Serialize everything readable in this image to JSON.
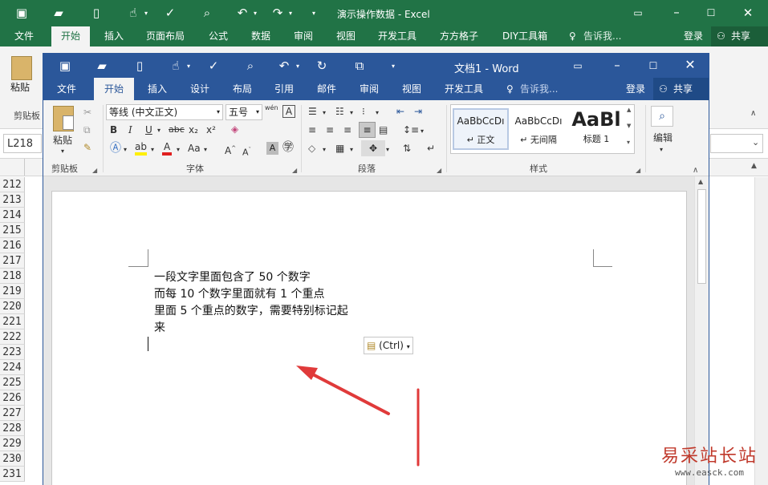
{
  "excel": {
    "window_title": "演示操作数据 - Excel",
    "tabs": [
      "文件",
      "开始",
      "插入",
      "页面布局",
      "公式",
      "数据",
      "审阅",
      "视图",
      "开发工具",
      "方方格子",
      "DIY工具箱"
    ],
    "tell_me": "告诉我...",
    "login": "登录",
    "share": "共享",
    "paste_label": "粘贴",
    "clipboard_label": "剪贴板",
    "name_box": "L218",
    "row_numbers": [
      "212",
      "213",
      "214",
      "215",
      "216",
      "217",
      "218",
      "219",
      "220",
      "221",
      "222",
      "223",
      "224",
      "225",
      "226",
      "227",
      "228",
      "229",
      "230",
      "231"
    ]
  },
  "word": {
    "window_title": "文档1 - Word",
    "tabs": [
      "文件",
      "开始",
      "插入",
      "设计",
      "布局",
      "引用",
      "邮件",
      "审阅",
      "视图",
      "开发工具"
    ],
    "tell_me": "告诉我...",
    "login": "登录",
    "share": "共享",
    "ribbon": {
      "paste_label": "粘贴",
      "clipboard_group": "剪贴板",
      "font_name": "等线 (中文正文)",
      "font_size": "五号",
      "wen_glyph": "wén",
      "font_group": "字体",
      "paragraph_group": "段落",
      "styles_group": "样式",
      "edit_label": "编辑",
      "bold": "B",
      "italic": "I",
      "underline": "U",
      "strike": "abc",
      "subscript": "x₂",
      "superscript": "x²",
      "styles": [
        {
          "sample": "AaBbCcDı",
          "name": "↵ 正文"
        },
        {
          "sample": "AaBbCcDı",
          "name": "↵ 无间隔"
        },
        {
          "sample": "AaBl",
          "name": "标题 1"
        }
      ]
    },
    "document_lines": [
      "一段文字里面包含了 50 个数字",
      "而每 10 个数字里面就有 1 个重点",
      "里面 5 个重点的数字，需要特别标记起",
      "来"
    ],
    "paste_options": "(Ctrl)"
  },
  "watermark": {
    "cn": "易采站长站",
    "url": "www.easck.com"
  },
  "colors": {
    "excel_green": "#217346",
    "word_blue": "#2b579a",
    "arrow_red": "#e03a3a"
  }
}
